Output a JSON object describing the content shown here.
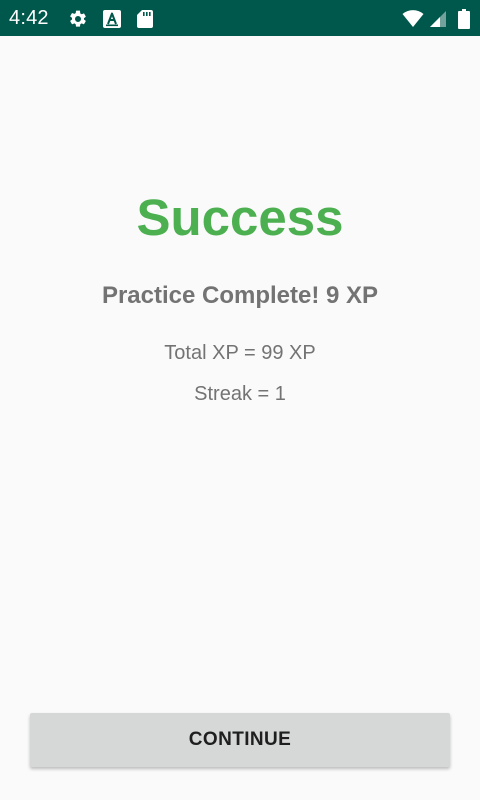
{
  "status_bar": {
    "time": "4:42",
    "background": "#00574b",
    "left_icons": [
      "settings-gear-icon",
      "font-a-icon",
      "sd-card-icon"
    ],
    "right_icons": [
      "wifi-icon",
      "cell-signal-icon",
      "battery-icon"
    ]
  },
  "result": {
    "title": "Success",
    "title_color": "#4caf50",
    "subtitle": "Practice Complete! 9 XP",
    "total_xp": "Total XP = 99 XP",
    "streak": "Streak = 1"
  },
  "actions": {
    "continue_label": "CONTINUE"
  }
}
